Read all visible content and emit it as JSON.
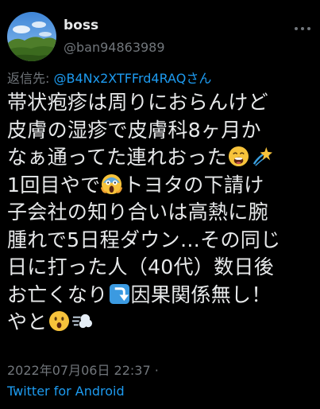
{
  "author": {
    "display_name": "boss",
    "handle": "@ban94863989"
  },
  "reply": {
    "prefix": "返信先: ",
    "handle": "@B4Nx2XTFFrd4RAQ",
    "suffix": "さん"
  },
  "tweet": {
    "line1": "帯状疱疹は周りにおらんけど",
    "line2": "皮膚の湿疹で皮膚科8ヶ月か",
    "line3": "なぁ通ってた連れおった",
    "line4a": "1回目やで",
    "line4b": "トヨタの下請け",
    "line5": "子会社の知り合いは高熱に腕",
    "line6": "腫れで5日程ダウン…その同じ",
    "line7": "日に打った人（40代）数日後",
    "line8a": "お亡くなり",
    "line8b": "因果関係無し！",
    "line9": "やと",
    "emoji_names": [
      "weary-face-emoji",
      "dizzy-emoji",
      "screaming-face-emoji",
      "arrow-down-emoji",
      "hushed-face-emoji",
      "dash-emoji"
    ]
  },
  "meta": {
    "timestamp": "2022年07月06日 22:37 ·",
    "source": "Twitter for Android"
  },
  "colors": {
    "background": "#000000",
    "text": "#e7e9ea",
    "secondary": "#71767b",
    "link": "#1d9bf0"
  }
}
